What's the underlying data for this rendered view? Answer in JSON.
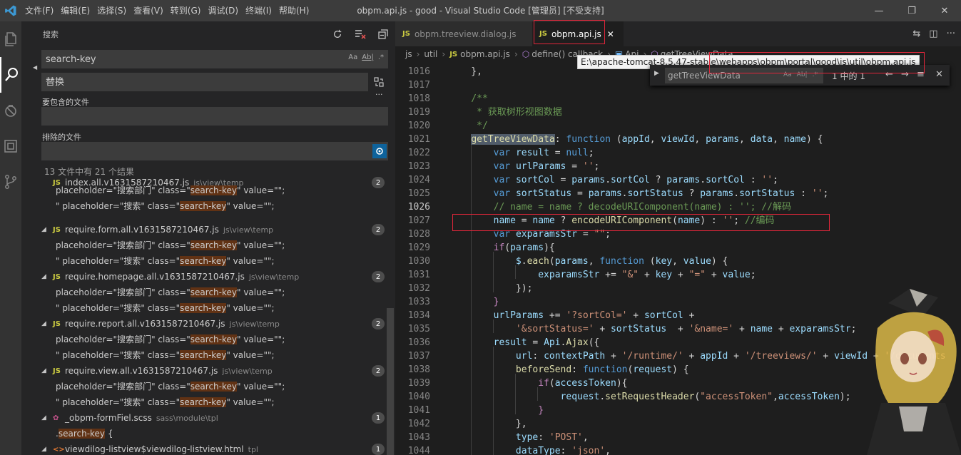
{
  "titlebar": {
    "menus": [
      "文件(F)",
      "编辑(E)",
      "选择(S)",
      "查看(V)",
      "转到(G)",
      "调试(D)",
      "终端(I)",
      "帮助(H)"
    ],
    "title": "obpm.api.js - good - Visual Studio Code [管理员] [不受支持]"
  },
  "sidebar": {
    "header": "搜索",
    "search_value": "search-key",
    "replace_placeholder": "替换",
    "include_label": "要包含的文件",
    "exclude_label": "排除的文件",
    "case_opt": "Aa",
    "word_opt": "Ab|",
    "regex_opt": ".*",
    "summary": "13 文件中有 21 个结果",
    "files": [
      {
        "name": "index.all.v1631587210467.js",
        "path": "js\\view\\temp",
        "count": "2"
      },
      {
        "name": "require.form.all.v1631587210467.js",
        "path": "js\\view\\temp",
        "count": "2"
      },
      {
        "name": "require.homepage.all.v1631587210467.js",
        "path": "js\\view\\temp",
        "count": "2"
      },
      {
        "name": "require.report.all.v1631587210467.js",
        "path": "js\\view\\temp",
        "count": "2"
      },
      {
        "name": "require.view.all.v1631587210467.js",
        "path": "js\\view\\temp",
        "count": "2"
      },
      {
        "name": "_obpm-formFiel.scss",
        "path": "sass\\module\\tpl",
        "count": "1"
      },
      {
        "name": "viewdilog-listview$viewdilog-listview.html",
        "path": "tpl",
        "count": "1"
      }
    ],
    "match_a_pre": "placeholder=\"搜索部门\" class=\"",
    "match_b_pre": "\" placeholder=\"搜索\" class=\"",
    "match_term": "search-key",
    "match_post": "\" value=\"\";",
    "scss_match_pre": ".",
    "scss_match_post": " {"
  },
  "tabs": [
    {
      "label": "obpm.treeview.dialog.js",
      "active": false
    },
    {
      "label": "obpm.api.js",
      "active": true
    }
  ],
  "tab_icon": "JS",
  "breadcrumb": [
    "js",
    "util",
    "obpm.api.js",
    "define() callback",
    "Api",
    "getTreeViewData"
  ],
  "tooltip": "E:\\apache-tomcat-8.5.47-stable\\webapps\\obpm\\portal\\good\\js\\util\\obpm.api.js",
  "find": {
    "value": "getTreeViewData",
    "count": "1 中的 1"
  },
  "code": {
    "line_numbers": [
      "1016",
      "1017",
      "1018",
      "1019",
      "1020",
      "1021",
      "1022",
      "1023",
      "1024",
      "1025",
      "1026",
      "1027",
      "1028",
      "1029",
      "1030",
      "1031",
      "1032",
      "1033",
      "1034",
      "1035",
      "1036",
      "1037",
      "1038",
      "1039",
      "1040",
      "1041",
      "1042",
      "1043",
      "1044"
    ],
    "current_line": "1026"
  },
  "colors": {
    "accent": "#007acc",
    "match_highlight": "#613214",
    "annotation_red": "#e0263a"
  },
  "icons": [
    "vscode-logo-icon",
    "explorer-icon",
    "search-icon",
    "debug-icon",
    "extensions-icon",
    "source-control-icon",
    "refresh-icon",
    "clear-results-icon",
    "collapse-all-icon",
    "replace-all-icon",
    "exclude-settings-icon",
    "split-editor-icon",
    "more-icon",
    "close-icon"
  ]
}
